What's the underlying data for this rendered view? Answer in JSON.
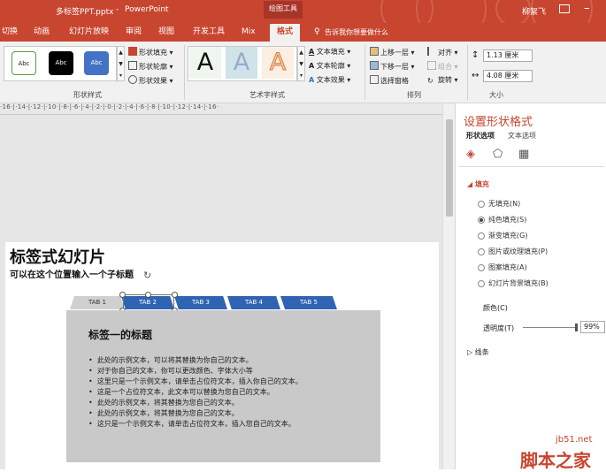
{
  "titlebar": {
    "filename": "多标签PPT.pptx",
    "sep": "-",
    "app": "PowerPoint",
    "context": "绘图工具",
    "user": "柳絮飞"
  },
  "tabs": [
    "切换",
    "动画",
    "幻灯片放映",
    "审阅",
    "视图",
    "开发工具",
    "Mix",
    "格式"
  ],
  "tellme": "告诉我你想要做什么",
  "ribbon": {
    "shape_styles": {
      "swatches": [
        "Abc",
        "Abc",
        "Abc"
      ],
      "fill": "形状填充",
      "outline": "形状轮廓",
      "effect": "形状效果",
      "label": "形状样式"
    },
    "wordart": {
      "letters": [
        "A",
        "A",
        "A"
      ],
      "text_fill": "文本填充",
      "text_outline": "文本轮廓",
      "text_effect": "文本效果",
      "label": "艺术字样式"
    },
    "arrange": {
      "bring_forward": "上移一层",
      "send_backward": "下移一层",
      "selection_pane": "选择窗格",
      "align": "对齐",
      "group": "组合",
      "rotate": "旋转",
      "label": "排列"
    },
    "size": {
      "height": "1.13 厘米",
      "width": "4.08 厘米",
      "label": "大小"
    }
  },
  "ruler": "·16·|·14·|·12·|·10·|·8·|·6·|·4·|·2·|·0·|·2·|·4·|·6·|·8·|·10·|·12·|·14·|·16·",
  "slide": {
    "title": "标签式幻灯片",
    "subtitle": "可以在这个位置输入一个子标题",
    "tabs": [
      "TAB 1",
      "TAB 2",
      "TAB 3",
      "TAB 4",
      "TAB 5"
    ],
    "panel_title": "标签一的标题",
    "bullets": [
      "此处的示例文本，可以将其替换为你自己的文本。",
      "对于你自己的文本，你可以更改颜色、字体大小等",
      "这里只是一个示例文本，请单击占位符文本，插入你自己的文本。",
      "这是一个占位符文本，此文本可以替换为您自己的文本。",
      "此处的示例文本，将其替换为您自己的文本。",
      "此处的示例文本，将其替换为您自己的文本。",
      "这只是一个示例文本，请单击占位符文本，插入您自己的文本。"
    ]
  },
  "pane": {
    "title": "设置形状格式",
    "tab_shape": "形状选项",
    "tab_text": "文本选项",
    "fill_header": "填充",
    "fill_options": [
      "无填充(N)",
      "纯色填充(S)",
      "渐变填充(G)",
      "图片或纹理填充(P)",
      "图案填充(A)",
      "幻灯片背景填充(B)"
    ],
    "selected_fill": 1,
    "color_label": "颜色(C)",
    "transparency_label": "透明度(T)",
    "transparency_value": "99%",
    "line_header": "线条"
  },
  "watermark": {
    "site": "jb51.net",
    "brand": "脚本之家"
  },
  "colors": {
    "accent": "#c8452f",
    "tab_blue": "#2f64b3",
    "panel_gray": "#c9c9c9"
  }
}
